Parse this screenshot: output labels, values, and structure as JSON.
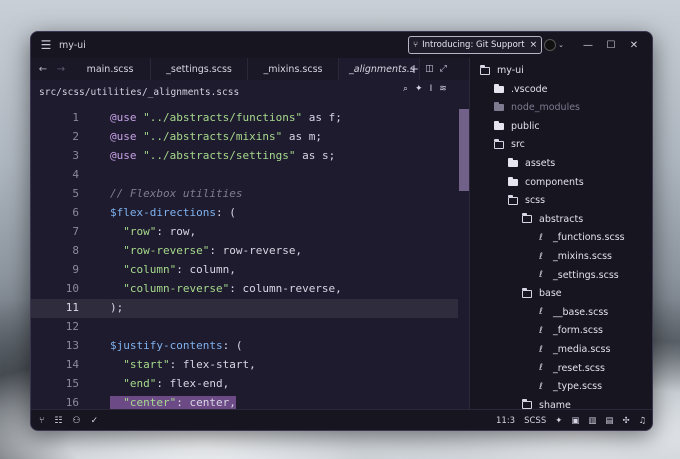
{
  "titlebar": {
    "app_name": "my-ui",
    "notice": "Introducing: Git Support",
    "notice_close": "×",
    "minimize": "—",
    "maximize": "☐",
    "close": "✕"
  },
  "tabs": [
    {
      "label": "main.scss",
      "active": false
    },
    {
      "label": "_settings.scss",
      "active": false
    },
    {
      "label": "_mixins.scss",
      "active": false
    },
    {
      "label": "_alignments.s",
      "active": true
    }
  ],
  "tab_actions": {
    "new": "+",
    "close": "×"
  },
  "path": "src/scss/utilities/_alignments.scss",
  "editor": {
    "current_line": 11,
    "lines": [
      {
        "n": "1",
        "parts": [
          [
            "at",
            "@use"
          ],
          [
            "p",
            " "
          ],
          [
            "str",
            "\"../abstracts/functions\""
          ],
          [
            "p",
            " as f;"
          ]
        ]
      },
      {
        "n": "2",
        "parts": [
          [
            "at",
            "@use"
          ],
          [
            "p",
            " "
          ],
          [
            "str",
            "\"../abstracts/mixins\""
          ],
          [
            "p",
            " as m;"
          ]
        ]
      },
      {
        "n": "3",
        "parts": [
          [
            "at",
            "@use"
          ],
          [
            "p",
            " "
          ],
          [
            "str",
            "\"../abstracts/settings\""
          ],
          [
            "p",
            " as s;"
          ]
        ]
      },
      {
        "n": "4",
        "parts": []
      },
      {
        "n": "5",
        "parts": [
          [
            "cm",
            "// Flexbox utilities"
          ]
        ]
      },
      {
        "n": "6",
        "parts": [
          [
            "var",
            "$flex-directions"
          ],
          [
            "p",
            ": ("
          ]
        ]
      },
      {
        "n": "7",
        "parts": [
          [
            "p",
            "  "
          ],
          [
            "str",
            "\"row\""
          ],
          [
            "p",
            ": row,"
          ]
        ]
      },
      {
        "n": "8",
        "parts": [
          [
            "p",
            "  "
          ],
          [
            "str",
            "\"row-reverse\""
          ],
          [
            "p",
            ": row-reverse,"
          ]
        ]
      },
      {
        "n": "9",
        "parts": [
          [
            "p",
            "  "
          ],
          [
            "str",
            "\"column\""
          ],
          [
            "p",
            ": column,"
          ]
        ]
      },
      {
        "n": "10",
        "parts": [
          [
            "p",
            "  "
          ],
          [
            "str",
            "\"column-reverse\""
          ],
          [
            "p",
            ": column-reverse,"
          ]
        ]
      },
      {
        "n": "11",
        "parts": [
          [
            "p",
            ");"
          ]
        ]
      },
      {
        "n": "12",
        "parts": []
      },
      {
        "n": "13",
        "parts": [
          [
            "var",
            "$justify-contents"
          ],
          [
            "p",
            ": ("
          ]
        ]
      },
      {
        "n": "14",
        "parts": [
          [
            "p",
            "  "
          ],
          [
            "str",
            "\"start\""
          ],
          [
            "p",
            ": flex-start,"
          ]
        ]
      },
      {
        "n": "15",
        "parts": [
          [
            "p",
            "  "
          ],
          [
            "str",
            "\"end\""
          ],
          [
            "p",
            ": flex-end,"
          ]
        ]
      },
      {
        "n": "16",
        "parts": [
          [
            "p",
            "  "
          ],
          [
            "str",
            "\"center\""
          ],
          [
            "p",
            ": center,"
          ]
        ]
      }
    ]
  },
  "tree": [
    {
      "label": "my-ui",
      "depth": 0,
      "icon": "folder-open-icon"
    },
    {
      "label": ".vscode",
      "depth": 1,
      "icon": "folder-icon"
    },
    {
      "label": "node_modules",
      "depth": 1,
      "icon": "folder-icon",
      "dim": true
    },
    {
      "label": "public",
      "depth": 1,
      "icon": "folder-icon"
    },
    {
      "label": "src",
      "depth": 1,
      "icon": "folder-open-icon"
    },
    {
      "label": "assets",
      "depth": 2,
      "icon": "folder-icon"
    },
    {
      "label": "components",
      "depth": 2,
      "icon": "folder-icon"
    },
    {
      "label": "scss",
      "depth": 2,
      "icon": "folder-open-icon"
    },
    {
      "label": "abstracts",
      "depth": 3,
      "icon": "folder-open-icon"
    },
    {
      "label": "_functions.scss",
      "depth": 4,
      "icon": "sass-file-icon"
    },
    {
      "label": "_mixins.scss",
      "depth": 4,
      "icon": "sass-file-icon"
    },
    {
      "label": "_settings.scss",
      "depth": 4,
      "icon": "sass-file-icon"
    },
    {
      "label": "base",
      "depth": 3,
      "icon": "folder-open-icon"
    },
    {
      "label": "__base.scss",
      "depth": 4,
      "icon": "sass-file-icon"
    },
    {
      "label": "_form.scss",
      "depth": 4,
      "icon": "sass-file-icon"
    },
    {
      "label": "_media.scss",
      "depth": 4,
      "icon": "sass-file-icon"
    },
    {
      "label": "_reset.scss",
      "depth": 4,
      "icon": "sass-file-icon"
    },
    {
      "label": "_type.scss",
      "depth": 4,
      "icon": "sass-file-icon"
    },
    {
      "label": "shame",
      "depth": 3,
      "icon": "folder-open-icon"
    }
  ],
  "status": {
    "cursor": "11:3",
    "language": "SCSS",
    "check": "✓"
  },
  "colors": {
    "accent": "#8e7aa8",
    "background": "#1e1b2e",
    "string": "#a6d98b",
    "keyword": "#c7a2e6",
    "variable": "#7fb2ee"
  }
}
